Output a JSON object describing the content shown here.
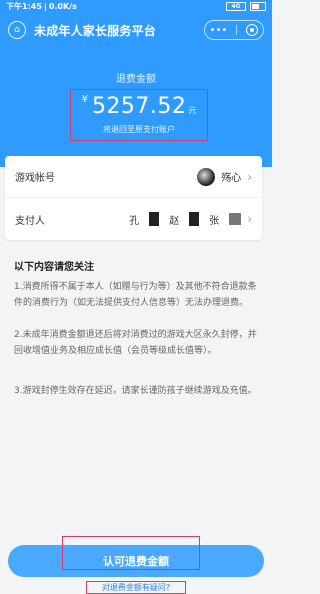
{
  "status_bar": {
    "time": "下午1:45",
    "speed": "0.0K/s",
    "battery": ""
  },
  "header": {
    "title": "未成年人家长服务平台",
    "capsule_more": "•••"
  },
  "hero": {
    "label": "退费金额",
    "currency": "¥",
    "amount": "5257.52",
    "unit": "元",
    "refund_note": "将退回至原支付账户"
  },
  "info": {
    "game_account_label": "游戏帐号",
    "game_account_value": "殇心",
    "payer_label": "支付人",
    "payer_chars": [
      "孔",
      "赵",
      "张"
    ]
  },
  "notice": {
    "title": "以下内容请您关注",
    "items": [
      "1.消费所得不属于本人（如赠与行为等）及其他不符合退款条件的消费行为（如无法提供支付人信息等）无法办理退费。",
      "2.未成年消费金额退还后将对消费过的游戏大区永久封停，并回收增值业务及相应成长值（会员等级成长值等）。",
      "3.游戏封停生效存在延迟，请家长谨防孩子继续游戏及充值。"
    ]
  },
  "actions": {
    "confirm_label": "认可退费金额",
    "dispute_link": "对退费金额有疑问?"
  },
  "colors": {
    "primary": "#2f9bff",
    "button": "#4aa8ff",
    "highlight": "#d43c6b"
  }
}
